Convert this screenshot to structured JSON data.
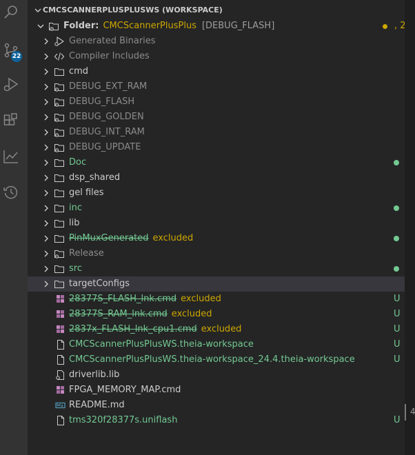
{
  "activity_bar": {
    "items": [
      {
        "name": "search-icon"
      },
      {
        "name": "source-control-icon"
      },
      {
        "name": "run-debug-icon"
      },
      {
        "name": "extensions-icon"
      },
      {
        "name": "chart-icon"
      },
      {
        "name": "history-icon"
      }
    ],
    "source_control_badge": "22"
  },
  "explorer": {
    "workspace_title": "CMCSCANNERPLUSPLUSWS (WORKSPACE)",
    "root": {
      "label_prefix": "Folder:",
      "project": "CMCScannerPlusPlus",
      "config": "[DEBUG_FLASH]",
      "count": "2"
    },
    "items": [
      {
        "label": "Generated Binaries",
        "kind": "special-binaries",
        "color": "#8b8b8b",
        "chevron": true
      },
      {
        "label": "Compiler Includes",
        "kind": "special-code",
        "color": "#8b8b8b",
        "chevron": true
      },
      {
        "label": "cmd",
        "kind": "folder",
        "color": "#cccccc",
        "chevron": true
      },
      {
        "label": "DEBUG_EXT_RAM",
        "kind": "folder-gear",
        "color": "#8b8b8b",
        "chevron": true
      },
      {
        "label": "DEBUG_FLASH",
        "kind": "folder-gear",
        "color": "#8b8b8b",
        "chevron": true
      },
      {
        "label": "DEBUG_GOLDEN",
        "kind": "folder-gear",
        "color": "#8b8b8b",
        "chevron": true
      },
      {
        "label": "DEBUG_INT_RAM",
        "kind": "folder-gear",
        "color": "#8b8b8b",
        "chevron": true
      },
      {
        "label": "DEBUG_UPDATE",
        "kind": "folder-gear",
        "color": "#8b8b8b",
        "chevron": true
      },
      {
        "label": "Doc",
        "kind": "folder",
        "color": "#73c991",
        "chevron": true,
        "dot": "#73c991"
      },
      {
        "label": "dsp_shared",
        "kind": "folder",
        "color": "#cccccc",
        "chevron": true
      },
      {
        "label": "gel files",
        "kind": "folder",
        "color": "#cccccc",
        "chevron": true
      },
      {
        "label": "inc",
        "kind": "folder",
        "color": "#73c991",
        "chevron": true,
        "dot": "#73c991"
      },
      {
        "label": "lib",
        "kind": "folder",
        "color": "#cccccc",
        "chevron": true
      },
      {
        "label": "PinMuxGenerated",
        "kind": "folder",
        "color": "#73c991",
        "chevron": true,
        "strike": true,
        "excluded": "excluded",
        "dot": "#73c991"
      },
      {
        "label": "Release",
        "kind": "folder-gear",
        "color": "#8b8b8b",
        "chevron": true
      },
      {
        "label": "src",
        "kind": "folder",
        "color": "#73c991",
        "chevron": true,
        "dot": "#73c991"
      },
      {
        "label": "targetConfigs",
        "kind": "folder",
        "color": "#cccccc",
        "chevron": true,
        "selected": true
      },
      {
        "label": "28377S_FLASH_lnk.cmd",
        "kind": "cmd-file",
        "color": "#73c991",
        "strike": true,
        "excluded": "excluded",
        "status": "U"
      },
      {
        "label": "28377S_RAM_lnk.cmd",
        "kind": "cmd-file",
        "color": "#73c991",
        "strike": true,
        "excluded": "excluded",
        "status": "U"
      },
      {
        "label": "2837x_FLASH_lnk_cpu1.cmd",
        "kind": "cmd-file",
        "color": "#73c991",
        "strike": true,
        "excluded": "excluded",
        "status": "U"
      },
      {
        "label": "CMCScannerPlusPlusWS.theia-workspace",
        "kind": "file",
        "color": "#73c991",
        "status": "U"
      },
      {
        "label": "CMCScannerPlusPlusWS.theia-workspace_24.4.theia-workspace",
        "kind": "file",
        "color": "#73c991",
        "status": "U"
      },
      {
        "label": "driverlib.lib",
        "kind": "lib-file",
        "color": "#cccccc"
      },
      {
        "label": "FPGA_MEMORY_MAP.cmd",
        "kind": "cmd-file",
        "color": "#cccccc"
      },
      {
        "label": "README.md",
        "kind": "md-file",
        "color": "#cccccc"
      },
      {
        "label": "tms320f28377s.uniflash",
        "kind": "file",
        "color": "#73c991",
        "status": "U"
      }
    ]
  },
  "edge": {
    "glyph": "4"
  },
  "colors": {
    "git_untracked": "#73c991",
    "warning": "#cca700",
    "dimmed": "#8b8b8b",
    "cmd_icon": "#c586c0",
    "md_icon": "#519aba"
  }
}
